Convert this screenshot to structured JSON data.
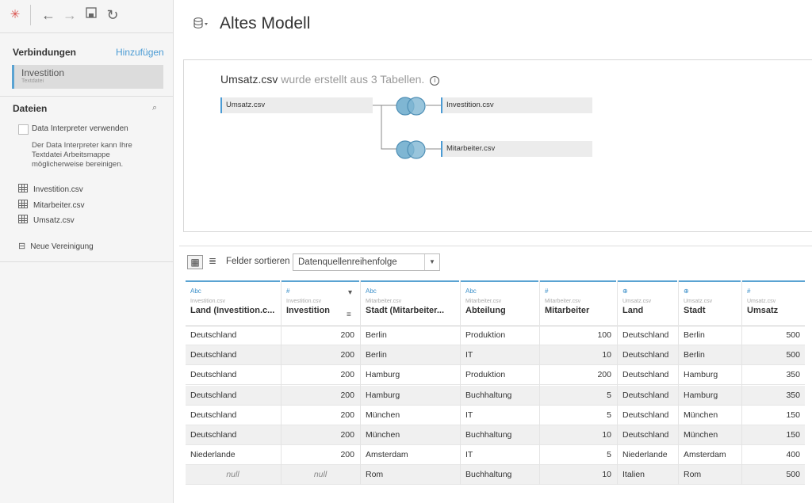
{
  "left": {
    "connections_title": "Verbindungen",
    "add_label": "Hinzufügen",
    "connection": {
      "name": "Investition",
      "type": "Textdatei"
    },
    "files_title": "Dateien",
    "data_interpreter_label": "Data Interpreter verwenden",
    "data_interpreter_text": "Der Data Interpreter kann Ihre Textdatei Arbeitsmappe möglicherweise bereinigen.",
    "files": [
      "Investition.csv",
      "Mitarbeiter.csv",
      "Umsatz.csv"
    ],
    "new_union": "Neue Vereinigung"
  },
  "datasource": {
    "title": "Altes Modell"
  },
  "canvas": {
    "title_strong": "Umsatz.csv",
    "title_rest": " wurde erstellt aus 3 Tabellen.",
    "tables": {
      "left": "Umsatz.csv",
      "right1": "Investition.csv",
      "right2": "Mitarbeiter.csv"
    }
  },
  "toolbar": {
    "sort_label": "Felder sortieren",
    "sort_value": "Datenquellenreihenfolge"
  },
  "grid": {
    "columns": [
      {
        "type": "Abc",
        "source": "Investition.csv",
        "name": "Land (Investition.c...",
        "num": false
      },
      {
        "type": "#",
        "source": "Investition.csv",
        "name": "Investition",
        "num": true
      },
      {
        "type": "Abc",
        "source": "Mitarbeiter.csv",
        "name": "Stadt (Mitarbeiter...",
        "num": false
      },
      {
        "type": "Abc",
        "source": "Mitarbeiter.csv",
        "name": "Abteilung",
        "num": false
      },
      {
        "type": "#",
        "source": "Mitarbeiter.csv",
        "name": "Mitarbeiter",
        "num": true
      },
      {
        "type": "globe",
        "source": "Umsatz.csv",
        "name": "Land",
        "num": false
      },
      {
        "type": "globe",
        "source": "Umsatz.csv",
        "name": "Stadt",
        "num": false
      },
      {
        "type": "#",
        "source": "Umsatz.csv",
        "name": "Umsatz",
        "num": true
      }
    ],
    "rows": [
      [
        "Deutschland",
        "200",
        "Berlin",
        "Produktion",
        "100",
        "Deutschland",
        "Berlin",
        "500"
      ],
      [
        "Deutschland",
        "200",
        "Berlin",
        "IT",
        "10",
        "Deutschland",
        "Berlin",
        "500"
      ],
      [
        "Deutschland",
        "200",
        "Hamburg",
        "Produktion",
        "200",
        "Deutschland",
        "Hamburg",
        "350"
      ],
      [
        "Deutschland",
        "200",
        "Hamburg",
        "Buchhaltung",
        "5",
        "Deutschland",
        "Hamburg",
        "350"
      ],
      [
        "Deutschland",
        "200",
        "München",
        "IT",
        "5",
        "Deutschland",
        "München",
        "150"
      ],
      [
        "Deutschland",
        "200",
        "München",
        "Buchhaltung",
        "10",
        "Deutschland",
        "München",
        "150"
      ],
      [
        "Niederlande",
        "200",
        "Amsterdam",
        "IT",
        "5",
        "Niederlande",
        "Amsterdam",
        "400"
      ],
      [
        "null",
        "null",
        "Rom",
        "Buchhaltung",
        "10",
        "Italien",
        "Rom",
        "500"
      ]
    ]
  },
  "colors": {
    "accent": "#4a9bd4",
    "join": "#6aaed0"
  }
}
